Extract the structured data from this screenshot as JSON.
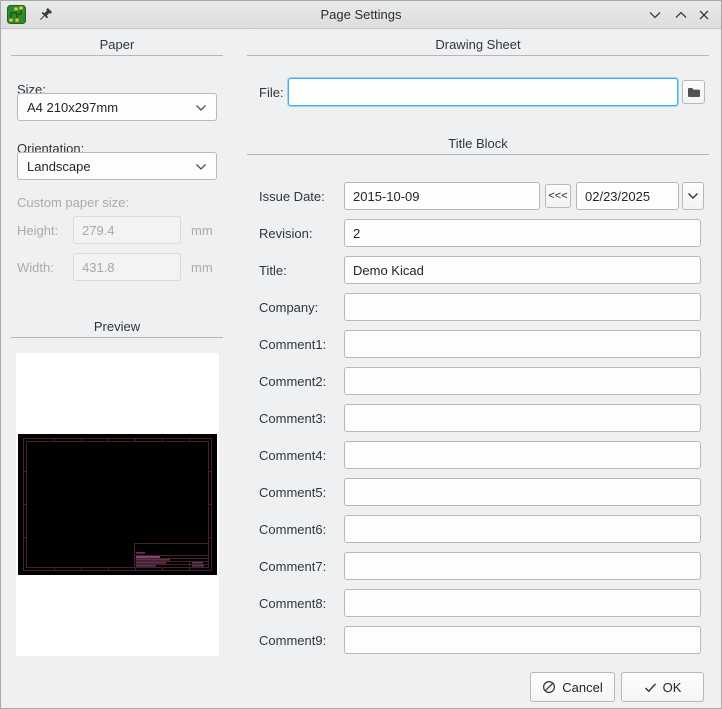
{
  "window": {
    "title": "Page Settings"
  },
  "paper": {
    "heading": "Paper",
    "size_label": "Size:",
    "size_value": "A4 210x297mm",
    "orientation_label": "Orientation:",
    "orientation_value": "Landscape",
    "custom_size_label": "Custom paper size:",
    "height_label": "Height:",
    "height_value": "279.4",
    "height_unit": "mm",
    "width_label": "Width:",
    "width_value": "431.8",
    "width_unit": "mm",
    "preview_heading": "Preview"
  },
  "drawing_sheet": {
    "heading": "Drawing Sheet",
    "file_label": "File:",
    "file_value": ""
  },
  "title_block": {
    "heading": "Title Block",
    "issue_date_label": "Issue Date:",
    "issue_date_value": "2015-10-09",
    "copy_date_button": "<<<",
    "date_picker_value": "02/23/2025",
    "rows": [
      {
        "label": "Revision:",
        "value": "2"
      },
      {
        "label": "Title:",
        "value": "Demo Kicad"
      },
      {
        "label": "Company:",
        "value": ""
      },
      {
        "label": "Comment1:",
        "value": ""
      },
      {
        "label": "Comment2:",
        "value": ""
      },
      {
        "label": "Comment3:",
        "value": ""
      },
      {
        "label": "Comment4:",
        "value": ""
      },
      {
        "label": "Comment5:",
        "value": ""
      },
      {
        "label": "Comment6:",
        "value": ""
      },
      {
        "label": "Comment7:",
        "value": ""
      },
      {
        "label": "Comment8:",
        "value": ""
      },
      {
        "label": "Comment9:",
        "value": ""
      }
    ]
  },
  "actions": {
    "cancel_label": "Cancel",
    "ok_label": "OK"
  },
  "icons": {
    "app": "kicad-app-icon",
    "pin": "pin-icon",
    "shade": "chevron-down-icon",
    "maximize": "chevron-up-icon",
    "close": "close-icon",
    "browse": "folder-icon",
    "cancel": "cancel-slash-icon",
    "ok": "check-icon"
  },
  "colors": {
    "accent_focus": "#3daee9",
    "dialog_bg": "#eff0f1",
    "preview_page_bg": "#000000",
    "preview_frame": "#46202c",
    "preview_text": "#a1588a"
  }
}
